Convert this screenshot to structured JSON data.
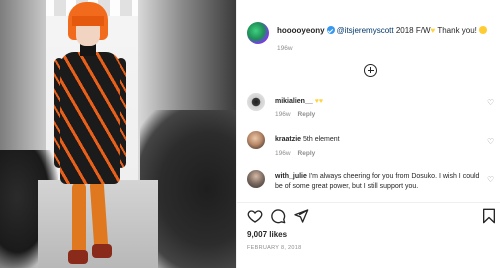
{
  "post": {
    "image_alt": "Runway model in orange wig and black-and-orange logo sweater dress",
    "author": "hooooyeony",
    "caption_mention": "@itsjeremyscott",
    "caption_text": " 2018 F/W",
    "caption_tail": " Thank you!",
    "caption_time": "196w",
    "load_more_icon": "plus-circle-icon"
  },
  "comments": [
    {
      "user": "mikialien__",
      "text": "",
      "time": "196w",
      "reply": "Reply"
    },
    {
      "user": "kraatzie",
      "text": "5th element",
      "time": "196w",
      "reply": "Reply"
    },
    {
      "user": "with_julie",
      "text": "I'm always cheering for you from Dosuko. I wish I could be of some great power, but I still support you.",
      "time": "",
      "reply": ""
    }
  ],
  "actions": {
    "like_icon": "heart-icon",
    "comment_icon": "comment-bubble-icon",
    "share_icon": "paper-plane-icon",
    "save_icon": "bookmark-icon"
  },
  "likes_text": "9,007 likes",
  "date_text": "FEBRUARY 8, 2018",
  "colors": {
    "text": "#262626",
    "secondary": "#8e8e8e",
    "mention": "#00376b",
    "verified": "#3897f0",
    "hair": "#f26a1b"
  }
}
